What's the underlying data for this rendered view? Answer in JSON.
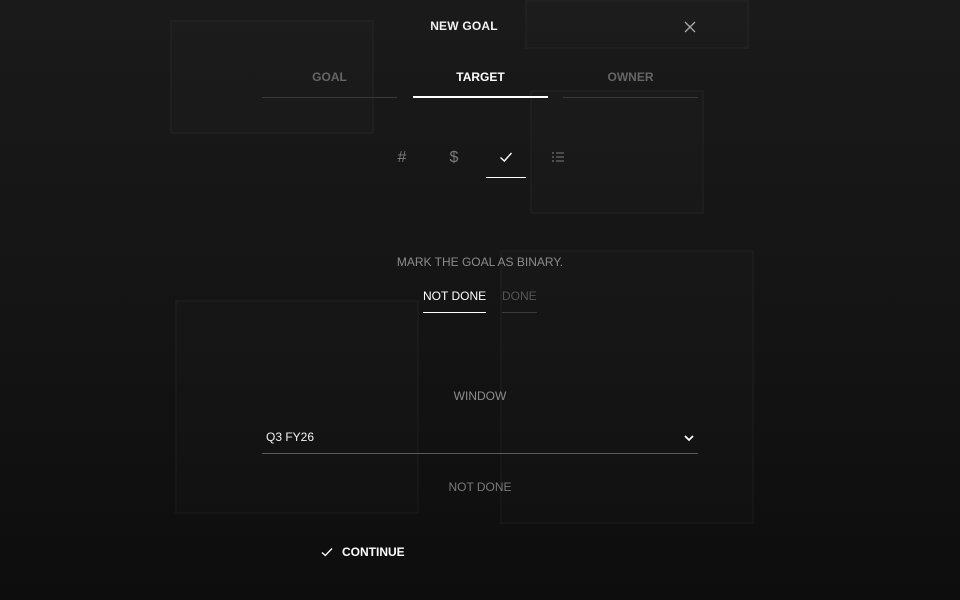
{
  "dialog": {
    "title": "NEW GOAL"
  },
  "tabs": [
    {
      "label": "GOAL",
      "active": false
    },
    {
      "label": "TARGET",
      "active": true
    },
    {
      "label": "OWNER",
      "active": false
    }
  ],
  "target_types": [
    {
      "icon": "hash-icon",
      "glyph": "#",
      "active": false
    },
    {
      "icon": "dollar-icon",
      "glyph": "$",
      "active": false
    },
    {
      "icon": "check-icon",
      "active": true
    },
    {
      "icon": "list-icon",
      "active": false
    }
  ],
  "binary": {
    "label": "MARK THE GOAL AS BINARY.",
    "options": [
      "NOT DONE",
      "DONE"
    ],
    "selected": "NOT DONE"
  },
  "window": {
    "label": "WINDOW",
    "value": "Q3 FY26"
  },
  "status": {
    "text": "NOT DONE"
  },
  "footer": {
    "continue_label": "CONTINUE"
  },
  "colors": {
    "background": "#111111",
    "accent": "#ffffff",
    "muted": "#7a7a7a"
  }
}
